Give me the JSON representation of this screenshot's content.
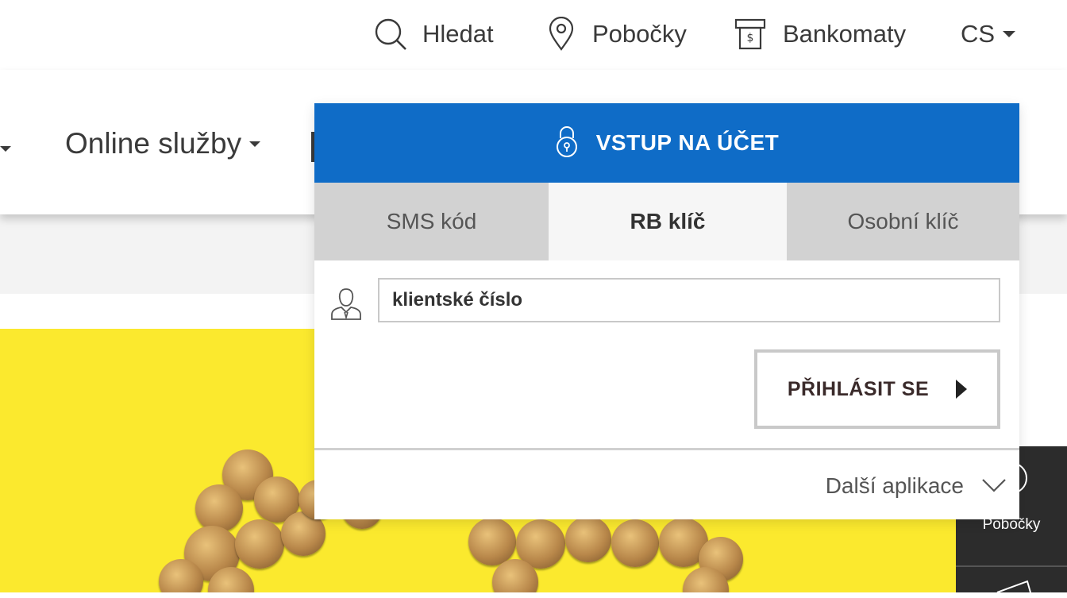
{
  "topbar": {
    "search_label": "Hledat",
    "branches_label": "Pobočky",
    "atms_label": "Bankomaty",
    "language": "CS"
  },
  "nav": {
    "online_services": "Online služby"
  },
  "login": {
    "title": "VSTUP NA ÚČET",
    "tabs": [
      {
        "label": "SMS kód",
        "active": false
      },
      {
        "label": "RB klíč",
        "active": true
      },
      {
        "label": "Osobní klíč",
        "active": false
      }
    ],
    "client_number_placeholder": "klientské číslo",
    "submit_label": "PŘIHLÁSIT SE",
    "more_apps_label": "Další aplikace"
  },
  "side_widget": {
    "branches_label": "Pobočky"
  },
  "colors": {
    "primary_blue": "#0f6cc7",
    "hero_yellow": "#fbe92e",
    "side_dark": "#2c2c2c",
    "tab_inactive": "#d2d2d2",
    "tab_active": "#f6f6f6"
  },
  "icons": [
    "search-icon",
    "map-pin-icon",
    "atm-icon",
    "chevron-down-icon",
    "lock-icon",
    "user-icon",
    "play-arrow-icon",
    "chevron-down-thin-icon"
  ]
}
